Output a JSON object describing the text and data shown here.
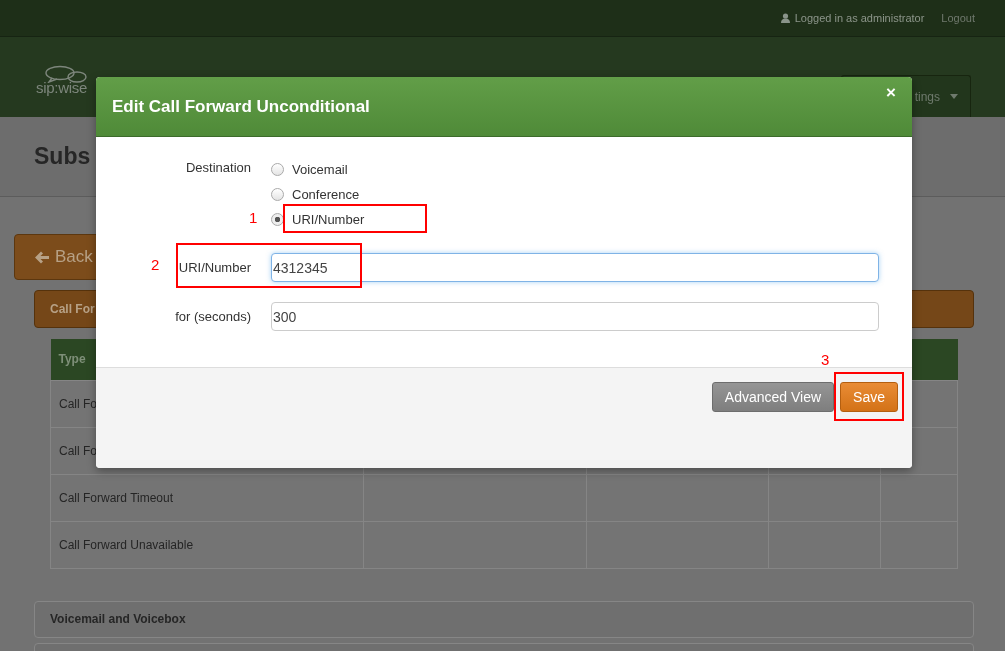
{
  "top_bar": {
    "user": "Logged in as administrator",
    "logout": "Logout"
  },
  "navbar": {
    "logo": "sip:wise",
    "settings_button": "tings"
  },
  "page_title": "Subs",
  "back_button": "Back",
  "panel": {
    "title": "Call For"
  },
  "table": {
    "columns": [
      "Type"
    ],
    "rows": [
      {
        "type": "Call Fo"
      },
      {
        "type": "Call Fo"
      },
      {
        "type": "Call Forward Timeout"
      },
      {
        "type": "Call Forward Unavailable"
      }
    ]
  },
  "sections": [
    "Voicemail and Voicebox"
  ],
  "modal": {
    "title": "Edit Call Forward Unconditional",
    "close": "×",
    "destination": {
      "label": "Destination",
      "options": [
        {
          "label": "Voicemail",
          "selected": false
        },
        {
          "label": "Conference",
          "selected": false
        },
        {
          "label": "URI/Number",
          "selected": true
        }
      ]
    },
    "fields": [
      {
        "label": "URI/Number",
        "value": "4312345",
        "focused": true
      },
      {
        "label": "for (seconds)",
        "value": "300",
        "focused": false
      }
    ],
    "buttons": [
      {
        "label": "Advanced View",
        "kind": "secondary"
      },
      {
        "label": "Save",
        "kind": "primary"
      }
    ]
  },
  "annotations": [
    {
      "number": "1"
    },
    {
      "number": "2"
    },
    {
      "number": "3"
    }
  ]
}
